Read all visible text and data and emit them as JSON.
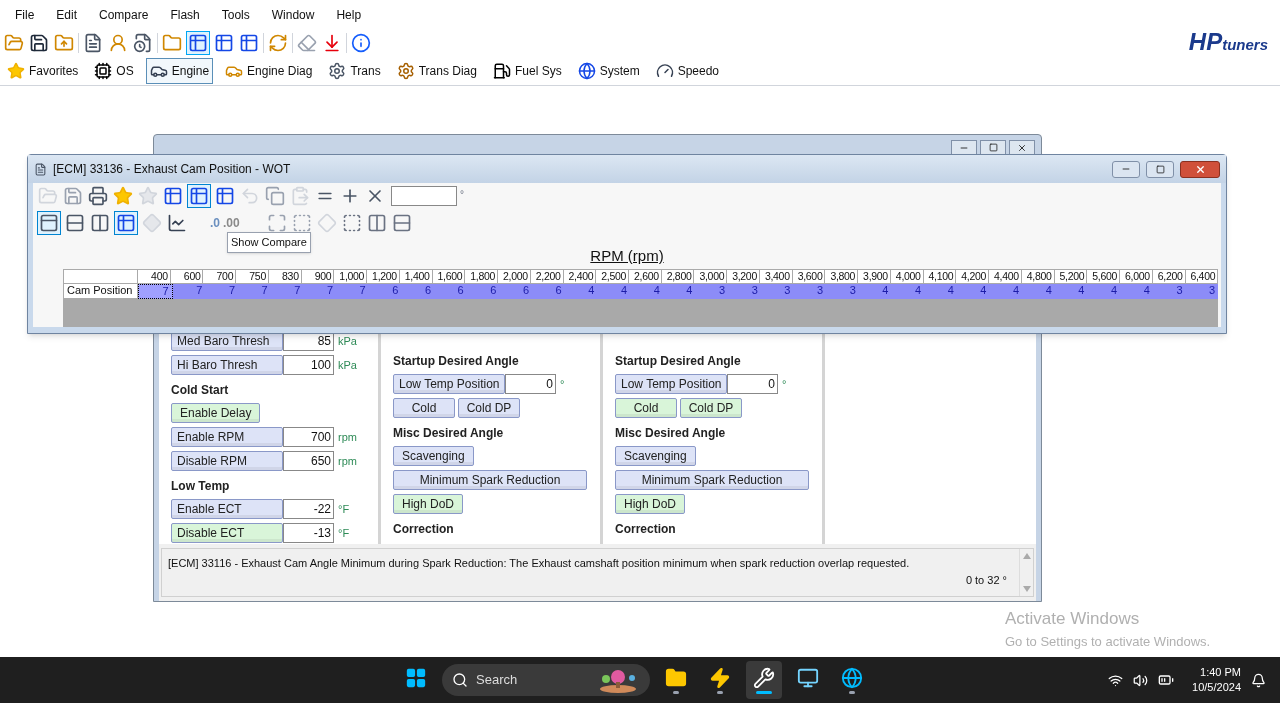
{
  "menu": [
    "File",
    "Edit",
    "Compare",
    "Flash",
    "Tools",
    "Window",
    "Help"
  ],
  "logo": {
    "brand": "HP",
    "suffix": "tuners"
  },
  "categories": [
    {
      "label": "Favorites",
      "selected": false
    },
    {
      "label": "OS",
      "selected": false
    },
    {
      "label": "Engine",
      "selected": true
    },
    {
      "label": "Engine Diag",
      "selected": false
    },
    {
      "label": "Trans",
      "selected": false
    },
    {
      "label": "Trans Diag",
      "selected": false
    },
    {
      "label": "Fuel Sys",
      "selected": false
    },
    {
      "label": "System",
      "selected": false
    },
    {
      "label": "Speedo",
      "selected": false
    }
  ],
  "front_window": {
    "title": "[ECM] 33136 - Exhaust Cam Position - WOT",
    "field_unit": "°",
    "decimal_buttons": [
      ".0",
      ".00"
    ],
    "tooltip": "Show Compare",
    "axis_title": "RPM (rpm)",
    "row_label": "Cam Position",
    "columns": [
      "400",
      "600",
      "700",
      "750",
      "830",
      "900",
      "1,000",
      "1,200",
      "1,400",
      "1,600",
      "1,800",
      "2,000",
      "2,200",
      "2,400",
      "2,500",
      "2,600",
      "2,800",
      "3,000",
      "3,200",
      "3,400",
      "3,600",
      "3,800",
      "3,900",
      "4,000",
      "4,100",
      "4,200",
      "4,400",
      "4,800",
      "5,200",
      "5,600",
      "6,000",
      "6,200",
      "6,400"
    ],
    "cells": [
      {
        "value": "7",
        "selected": true
      },
      {
        "value": "7",
        "selected": false
      },
      {
        "value": "7",
        "selected": false
      },
      {
        "value": "7",
        "selected": false
      },
      {
        "value": "7",
        "selected": false
      },
      {
        "value": "7",
        "selected": false
      },
      {
        "value": "7",
        "selected": false
      },
      {
        "value": "6",
        "selected": false
      },
      {
        "value": "6",
        "selected": false
      },
      {
        "value": "6",
        "selected": false
      },
      {
        "value": "6",
        "selected": false
      },
      {
        "value": "6",
        "selected": false
      },
      {
        "value": "6",
        "selected": false
      },
      {
        "value": "4",
        "selected": false
      },
      {
        "value": "4",
        "selected": false
      },
      {
        "value": "4",
        "selected": false
      },
      {
        "value": "4",
        "selected": false
      },
      {
        "value": "3",
        "selected": false
      },
      {
        "value": "3",
        "selected": false
      },
      {
        "value": "3",
        "selected": false
      },
      {
        "value": "3",
        "selected": false
      },
      {
        "value": "3",
        "selected": false
      },
      {
        "value": "4",
        "selected": false
      },
      {
        "value": "4",
        "selected": false
      },
      {
        "value": "4",
        "selected": false
      },
      {
        "value": "4",
        "selected": false
      },
      {
        "value": "4",
        "selected": false
      },
      {
        "value": "4",
        "selected": false
      },
      {
        "value": "4",
        "selected": false
      },
      {
        "value": "4",
        "selected": false
      },
      {
        "value": "4",
        "selected": false
      },
      {
        "value": "3",
        "selected": false
      },
      {
        "value": "3",
        "selected": false
      }
    ]
  },
  "background_window": {
    "columns": [
      {
        "items": [
          {
            "kind": "param",
            "label": "Med Baro Thresh",
            "value": "85",
            "unit": "kPa",
            "color": "#dde3f7"
          },
          {
            "kind": "param",
            "label": "Hi Baro Thresh",
            "value": "100",
            "unit": "kPa",
            "color": "#dde3f7"
          },
          {
            "kind": "heading",
            "label": "Cold Start"
          },
          {
            "kind": "button",
            "label": "Enable Delay",
            "color": "#d9f5d9",
            "wide": false
          },
          {
            "kind": "param",
            "label": "Enable RPM",
            "value": "700",
            "unit": "rpm",
            "color": "#dde3f7"
          },
          {
            "kind": "param",
            "label": "Disable RPM",
            "value": "650",
            "unit": "rpm",
            "color": "#dde3f7"
          },
          {
            "kind": "heading",
            "label": "Low Temp"
          },
          {
            "kind": "param",
            "label": "Enable ECT",
            "value": "-22",
            "unit": "°F",
            "color": "#dde3f7"
          },
          {
            "kind": "param",
            "label": "Disable ECT",
            "value": "-13",
            "unit": "°F",
            "color": "#d9f5d9"
          }
        ]
      },
      {
        "items": [
          {
            "kind": "heading",
            "label": "Startup Desired Angle"
          },
          {
            "kind": "param",
            "label": "Low Temp Position",
            "value": "0",
            "unit": "°",
            "color": "#dde3f7"
          },
          {
            "kind": "pair",
            "labels": [
              "Cold",
              "Cold DP"
            ],
            "color": "#dde3f7"
          },
          {
            "kind": "heading",
            "label": "Misc Desired Angle"
          },
          {
            "kind": "button",
            "label": "Scavenging",
            "color": "#dde3f7",
            "wide": false
          },
          {
            "kind": "button",
            "label": "Minimum Spark Reduction",
            "color": "#dde3f7",
            "wide": true
          },
          {
            "kind": "button",
            "label": "High DoD",
            "color": "#d9f5d9",
            "wide": false
          },
          {
            "kind": "heading",
            "label": "Correction"
          }
        ]
      },
      {
        "items": [
          {
            "kind": "heading",
            "label": "Startup Desired Angle"
          },
          {
            "kind": "param",
            "label": "Low Temp Position",
            "value": "0",
            "unit": "°",
            "color": "#dde3f7"
          },
          {
            "kind": "pair",
            "labels": [
              "Cold",
              "Cold DP"
            ],
            "color": "#d9f5d9"
          },
          {
            "kind": "heading",
            "label": "Misc Desired Angle"
          },
          {
            "kind": "button",
            "label": "Scavenging",
            "color": "#dde3f7",
            "wide": false
          },
          {
            "kind": "button",
            "label": "Minimum Spark Reduction",
            "color": "#dde3f7",
            "wide": true
          },
          {
            "kind": "button",
            "label": "High DoD",
            "color": "#d9f5d9",
            "wide": false
          },
          {
            "kind": "heading",
            "label": "Correction"
          }
        ]
      }
    ],
    "description": "[ECM] 33116 - Exhaust Cam Angle Minimum during Spark Reduction: The Exhaust camshaft position minimum when spark reduction overlap requested.",
    "range": "0 to 32 °"
  },
  "activation": {
    "title": "Activate Windows",
    "subtitle": "Go to Settings to activate Windows."
  },
  "taskbar": {
    "search_placeholder": "Search",
    "time": "1:40 PM",
    "date": "10/5/2024",
    "apps": [
      {
        "kind": "windows",
        "running": false,
        "selected": false
      },
      {
        "kind": "explorer",
        "running": true,
        "selected": false
      },
      {
        "kind": "bolt",
        "running": true,
        "selected": false
      },
      {
        "kind": "wrench",
        "running": true,
        "selected": true
      },
      {
        "kind": "terminal",
        "running": false,
        "selected": false
      },
      {
        "kind": "browser",
        "running": true,
        "selected": false
      }
    ]
  }
}
